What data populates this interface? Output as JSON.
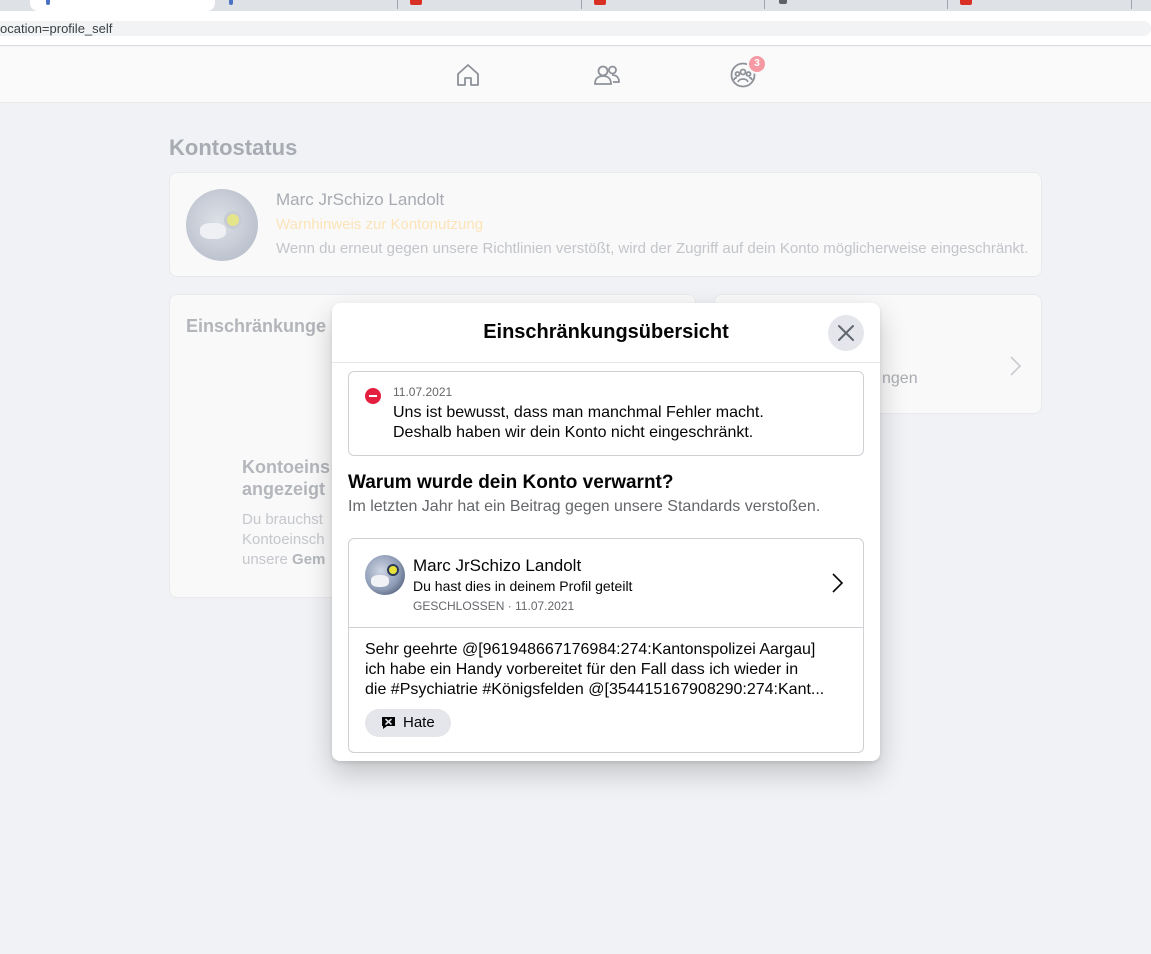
{
  "browser": {
    "url_fragment": "ocation=profile_self",
    "favicon_colors": [
      "#4a72c6",
      "#4a72c6",
      "#d93025",
      "#d93025",
      "#5f6368",
      "#d93025"
    ]
  },
  "nav": {
    "icons": [
      "home-icon",
      "friends-icon",
      "groups-icon"
    ],
    "badge_count": "3"
  },
  "background": {
    "heading": "Kontostatus",
    "status_card": {
      "name": "Marc JrSchizo Landolt",
      "warning": "Warnhinweis zur Kontonutzung",
      "description": "Wenn du erneut gegen unsere Richtlinien verstößt, wird der Zugriff auf dein Konto möglicherweise eingeschränkt."
    },
    "left_card": {
      "heading": "Einschränkunge",
      "subheading": "Kontoeins angezeigt",
      "desc_plain": "Du brauchst Kontoeinsch unsere ",
      "desc_bold": "Gem"
    },
    "right_card": {
      "partial_text": "ngen"
    }
  },
  "modal": {
    "title": "Einschränkungsübersicht",
    "close_label": "Close",
    "notice": {
      "date": "11.07.2021",
      "line1": "Uns ist bewusst, dass man manchmal Fehler macht.",
      "line2": "Deshalb haben wir dein Konto nicht eingeschränkt."
    },
    "why_title": "Warum wurde dein Konto verwarnt?",
    "why_subtitle": "Im letzten Jahr hat ein Beitrag gegen unsere Standards verstoßen.",
    "post": {
      "author": "Marc JrSchizo Landolt",
      "shared_text": "Du hast dies in deinem Profil geteilt",
      "meta": "GESCHLOSSEN · 11.07.2021",
      "body_line1": "Sehr geehrte @[961948667176984:274:Kantonspolizei Aargau]",
      "body_line2": "ich habe ein Handy vorbereitet für den Fall dass ich wieder in",
      "body_line3": "die #Psychiatrie #Königsfelden @[354415167908290:274:Kant...",
      "tag": "Hate"
    }
  }
}
